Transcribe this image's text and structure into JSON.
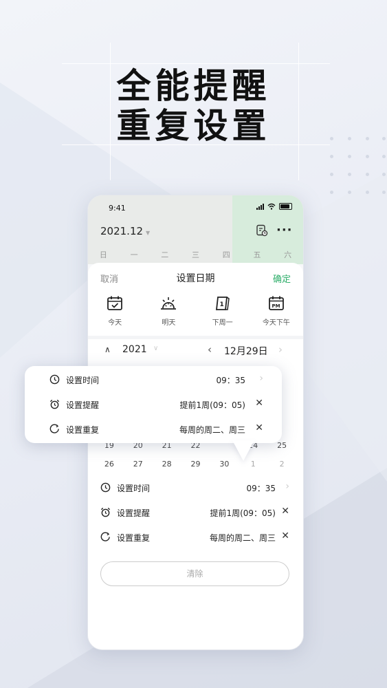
{
  "headline": {
    "line1": "全能提醒",
    "line2": "重复设置"
  },
  "statusbar": {
    "time": "9:41"
  },
  "calendar_header": {
    "month": "2021.12",
    "weekdays": [
      "日",
      "一",
      "二",
      "三",
      "四",
      "五",
      "六"
    ]
  },
  "sheet": {
    "cancel": "取消",
    "title": "设置日期",
    "confirm": "确定",
    "quick_options": [
      {
        "label": "今天",
        "icon": "calendar-check-icon"
      },
      {
        "label": "明天",
        "icon": "sunrise-icon"
      },
      {
        "label": "下周一",
        "icon": "calendar-page-icon"
      },
      {
        "label": "今天下午",
        "icon": "calendar-pm-icon"
      }
    ],
    "year": "2021",
    "date": "12月29日",
    "cal_rows": [
      [
        "19",
        "20",
        "21",
        "22",
        "",
        "24",
        "25"
      ],
      [
        "26",
        "27",
        "28",
        "29",
        "30",
        "1",
        "2"
      ]
    ],
    "options": [
      {
        "label": "设置时间",
        "value": "09：35",
        "action": "›",
        "icon": "clock-icon"
      },
      {
        "label": "设置提醒",
        "value": "提前1周(09：05)",
        "action": "✕",
        "icon": "alarm-icon"
      },
      {
        "label": "设置重复",
        "value": "每周的周二、周三",
        "action": "✕",
        "icon": "repeat-icon"
      }
    ],
    "clear": "清除"
  },
  "popup": {
    "options": [
      {
        "label": "设置时间",
        "value": "09：35",
        "action": "›",
        "icon": "clock-icon"
      },
      {
        "label": "设置提醒",
        "value": "提前1周(09：05)",
        "action": "✕",
        "icon": "alarm-icon"
      },
      {
        "label": "设置重复",
        "value": "每周的周二、周三",
        "action": "✕",
        "icon": "repeat-icon"
      }
    ]
  },
  "colors": {
    "accent": "#2eae6a",
    "today_col": "#d7ecdc"
  }
}
